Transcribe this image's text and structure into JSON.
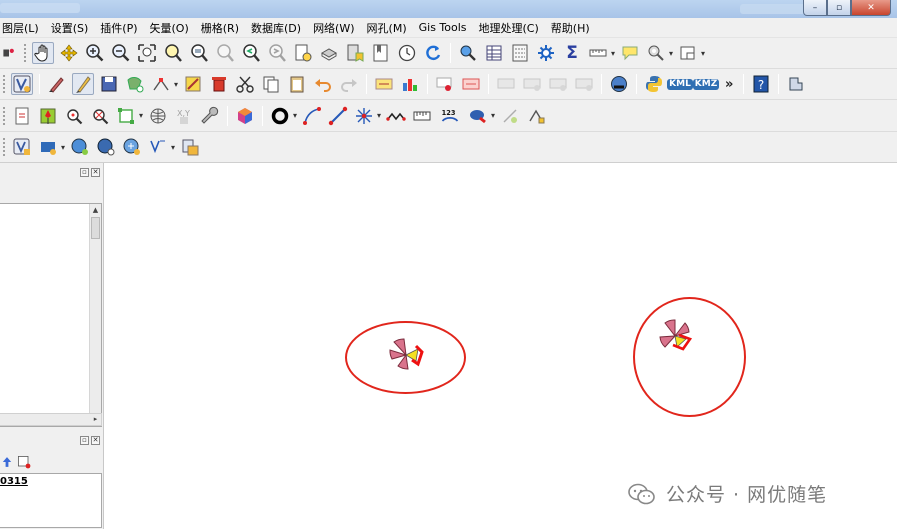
{
  "menubar": {
    "items": [
      "图层(L)",
      "设置(S)",
      "插件(P)",
      "矢量(O)",
      "栅格(R)",
      "数据库(D)",
      "网络(W)",
      "网孔(M)",
      "Gis Tools",
      "地理处理(C)",
      "帮助(H)"
    ]
  },
  "window_controls": {
    "minimize": "–",
    "restore": "▫",
    "close": "✕"
  },
  "toolbar1": {
    "icons": [
      "new-layer-icon",
      "pan-hand-icon",
      "pan-to-selection-icon",
      "zoom-in-icon",
      "zoom-out-icon",
      "zoom-full-icon",
      "zoom-to-selection-icon",
      "zoom-to-layer-icon",
      "zoom-native-icon",
      "zoom-last-icon",
      "zoom-next-icon",
      "new-map-view-icon",
      "new-3d-view-icon",
      "bookmark-new-icon",
      "bookmarks-icon",
      "temporal-clock-icon",
      "refresh-icon",
      "identify-icon",
      "attribute-table-icon",
      "field-calculator-icon",
      "processing-gear-icon",
      "statistics-sigma-icon",
      "measure-icon",
      "map-tips-icon",
      "select-features-icon",
      "deselect-icon"
    ]
  },
  "toolbar2": {
    "icons": [
      "add-vector-icon",
      "current-edits-icon",
      "toggle-editing-pencil-icon",
      "save-edits-icon",
      "add-feature-icon",
      "vertex-tool-icon",
      "modify-attributes-icon",
      "delete-selected-icon",
      "cut-features-icon",
      "copy-features-icon",
      "paste-features-icon",
      "undo-icon",
      "redo-icon",
      "label-icon",
      "diagram-options-icon",
      "label-pin-icon",
      "label-highlight-icon",
      "label-show-hide-icon",
      "label-move-icon",
      "label-rotate-icon",
      "label-change-icon",
      "globe-plugin-icon",
      "python-console-icon",
      "kml-import-icon",
      "kmz-export-icon",
      "help-icon",
      "plugin-manager-icon"
    ],
    "overflow": "»",
    "kml_label": "KML",
    "kmz_label": "KMZ"
  },
  "toolbar3": {
    "icons": [
      "new-shapefile-icon",
      "add-point-pin-icon",
      "pick-feature-icon",
      "zoom-to-point-icon",
      "georeference-icon",
      "web-globe-icon",
      "xy-coordinate-icon",
      "settings-wrench-icon",
      "cube-3d-icon",
      "circle-ring-icon",
      "curve-xy-icon",
      "add-line-icon",
      "add-star-points-icon",
      "zigzag-line-icon",
      "ruler-scale-icon",
      "label-123-icon",
      "snapping-cloud-icon",
      "vertex-add-icon",
      "topology-edit-icon"
    ],
    "counter_label": "123"
  },
  "toolbar4": {
    "icons": [
      "add-virtual-layer-icon",
      "add-wms-icon",
      "add-wfs-icon",
      "add-wcs-icon",
      "add-vector-tile-icon",
      "add-xyz-icon",
      "add-delimited-text-icon"
    ]
  },
  "left_panel": {
    "panel2_item": "0315"
  },
  "map": {
    "circle_color": "#e1261c",
    "symbol_color": "#d9738c",
    "accent_yellow": "#f4e120"
  },
  "watermark": {
    "text": "公众号 · 网优随笔"
  }
}
